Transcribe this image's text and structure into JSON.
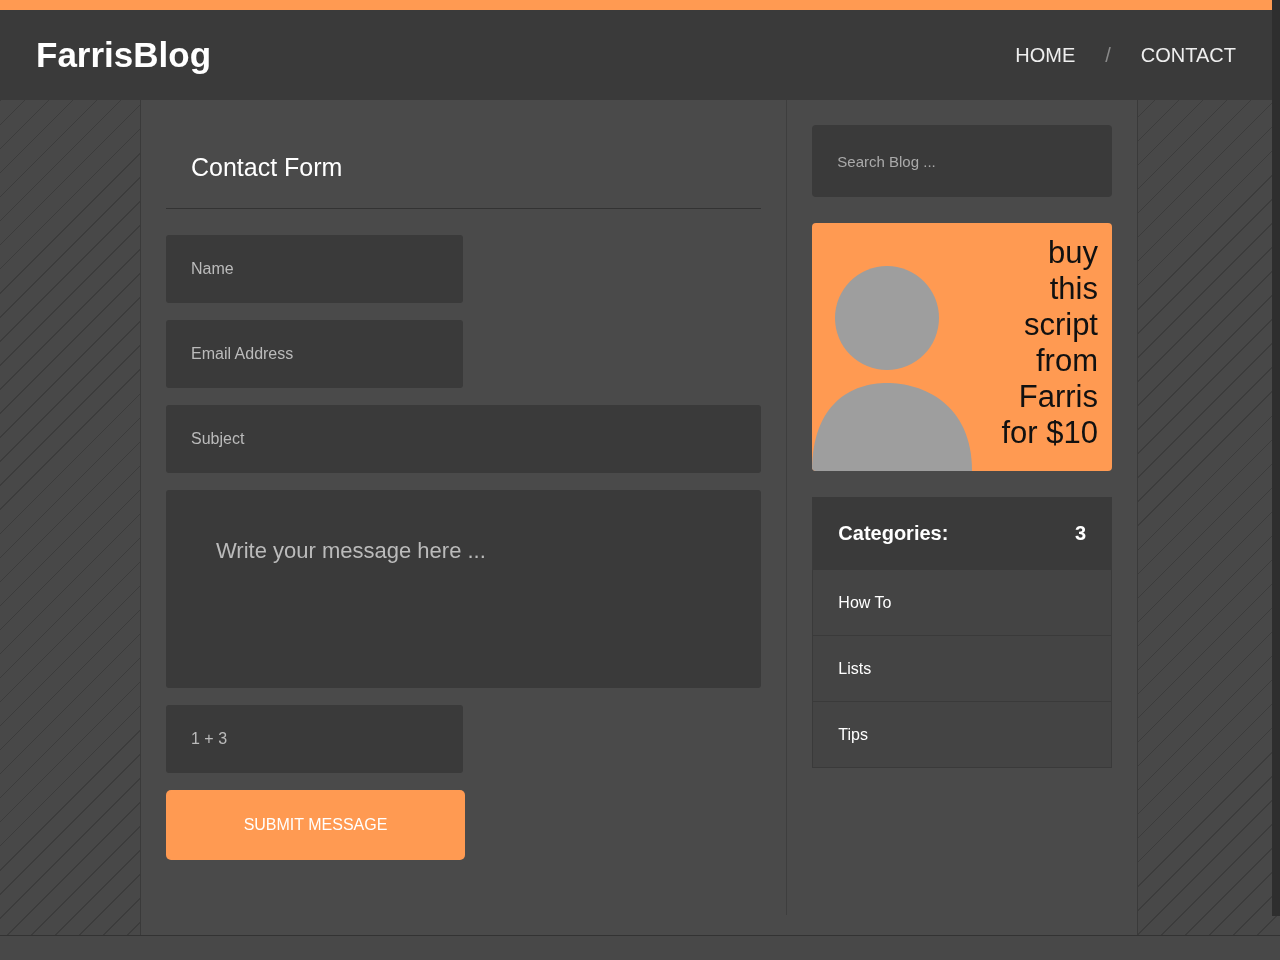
{
  "header": {
    "logo": "FarrisBlog",
    "nav": [
      {
        "label": "HOME",
        "selected": false
      },
      {
        "label": "CONTACT",
        "selected": false
      }
    ],
    "separator": "/"
  },
  "contact_form": {
    "title": "Contact Form",
    "fields": [
      {
        "kind": "short",
        "placeholder": "Name"
      },
      {
        "kind": "short",
        "placeholder": "Email Address"
      },
      {
        "kind": "wide",
        "placeholder": "Subject"
      },
      {
        "kind": "message",
        "placeholder": "Write your message here ..."
      },
      {
        "kind": "short",
        "placeholder": "1 + 3"
      }
    ],
    "submit": "SUBMIT MESSAGE"
  },
  "sidebar": {
    "search": {
      "placeholder": "Search Blog ..."
    },
    "ad": {
      "lines": [
        "buy",
        "this",
        "script",
        "from",
        "Farris",
        "for $10"
      ]
    },
    "categories": {
      "title": "Categories:",
      "count": "3",
      "items": [
        "How To",
        "Lists",
        "Tips"
      ]
    }
  }
}
